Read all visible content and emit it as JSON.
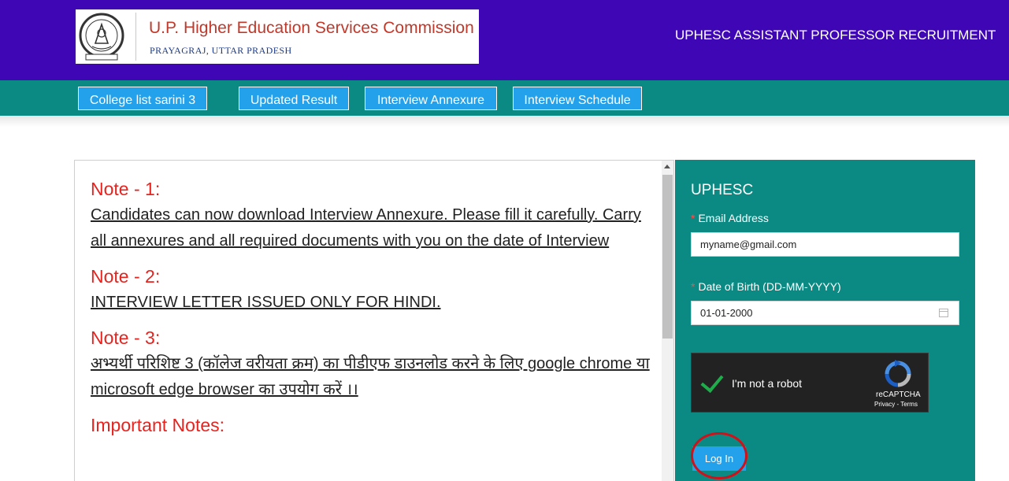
{
  "header": {
    "org_name": "U.P. Higher Education Services Commission",
    "org_place": "PRAYAGRAJ,  UTTAR PRADESH",
    "site_title": "UPHESC ASSISTANT PROFESSOR RECRUITMENT",
    "colors": {
      "header_bg": "#3f06b5",
      "nav_bg": "#0a8a83",
      "button_bg": "#23a1ea",
      "heading_red": "#e52420"
    }
  },
  "nav": {
    "buttons": [
      {
        "label": "College list sarini 3"
      },
      {
        "label": "Updated Result"
      },
      {
        "label": "Interview Annexure"
      },
      {
        "label": "Interview Schedule"
      }
    ]
  },
  "notes": {
    "items": [
      {
        "heading": "Note - 1:",
        "text": "Candidates can now download Interview Annexure. Please fill it carefully. Carry all annexures and all required documents with you on the date of Interview"
      },
      {
        "heading": "Note - 2:",
        "text": "INTERVIEW LETTER ISSUED ONLY FOR HINDI."
      },
      {
        "heading": "Note - 3:",
        "text": "अभ्यर्थी परिशिष्ट 3 (कॉलेज वरीयता क्रम) का पीडीएफ डाउनलोड करने के लिए google chrome या microsoft edge browser का उपयोग करें ।।"
      },
      {
        "heading": "Important Notes:"
      }
    ]
  },
  "login": {
    "title": "UPHESC",
    "email_label": "Email Address",
    "email_value": "myname@gmail.com",
    "dob_label": "Date of Birth (DD-MM-YYYY)",
    "dob_value": "01-01-2000",
    "required_marker": "*",
    "captcha_label": "I'm not a robot",
    "recaptcha_brand": "reCAPTCHA",
    "recaptcha_links": "Privacy - Terms",
    "button_label": "Log In"
  }
}
